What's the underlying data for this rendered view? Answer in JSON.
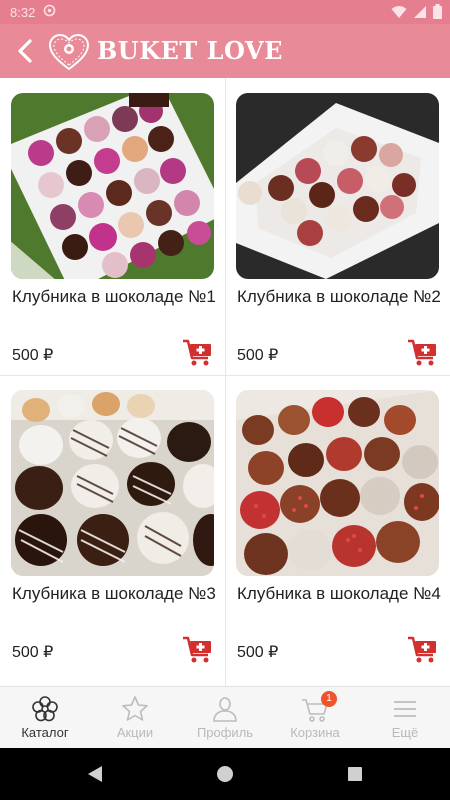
{
  "status_bar": {
    "time": "8:32"
  },
  "header": {
    "title": "BUKET LOVE"
  },
  "products": [
    {
      "title": "Клубника в шоколаде №1",
      "price": "500 ₽"
    },
    {
      "title": "Клубника в шоколаде №2",
      "price": "500 ₽"
    },
    {
      "title": "Клубника в шоколаде №3",
      "price": "500 ₽"
    },
    {
      "title": "Клубника в шоколаде №4",
      "price": "500 ₽"
    }
  ],
  "bottom_nav": {
    "items": [
      {
        "label": "Каталог",
        "icon": "flower-icon",
        "active": true
      },
      {
        "label": "Акции",
        "icon": "star-icon",
        "active": false
      },
      {
        "label": "Профиль",
        "icon": "person-icon",
        "active": false
      },
      {
        "label": "Корзина",
        "icon": "cart-icon",
        "active": false,
        "badge": "1"
      },
      {
        "label": "Ещё",
        "icon": "menu-icon",
        "active": false
      }
    ]
  },
  "colors": {
    "header": "#e98a98",
    "status_bar": "#e57f8f",
    "accent_red": "#d32f2f",
    "badge": "#f0542a"
  }
}
